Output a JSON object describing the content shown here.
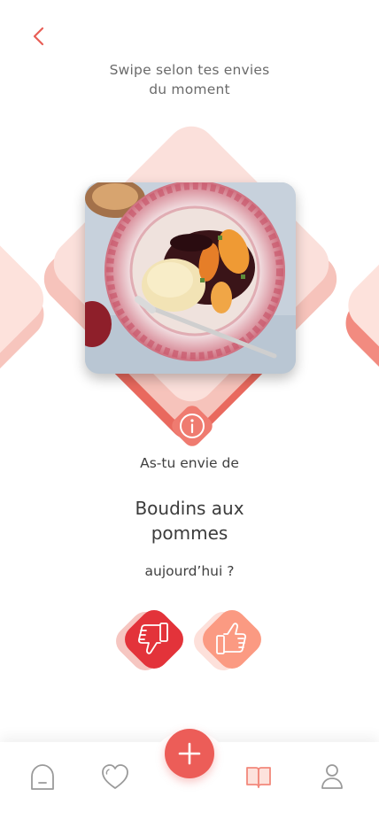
{
  "header": {
    "subtitle_line1": "Swipe selon tes envies",
    "subtitle_line2": "du moment"
  },
  "recipe": {
    "question": "As-tu envie de",
    "name": "Boudins aux pommes",
    "suffix": "aujourd’hui ?"
  },
  "actions": {
    "dislike_icon": "thumbs-down-icon",
    "like_icon": "thumbs-up-icon",
    "info_icon": "info-icon"
  },
  "nav": {
    "items": [
      {
        "icon": "home-icon",
        "active": false
      },
      {
        "icon": "heart-icon",
        "active": false
      },
      {
        "icon": "plus-icon",
        "active": false
      },
      {
        "icon": "book-icon",
        "active": true
      },
      {
        "icon": "user-icon",
        "active": false
      }
    ]
  },
  "colors": {
    "accent": "#ec5d58",
    "dislike": "#e3333a",
    "like": "#fb9a82",
    "diamond_light": "#fbe0db",
    "icon_gray": "#9a9a9a"
  }
}
